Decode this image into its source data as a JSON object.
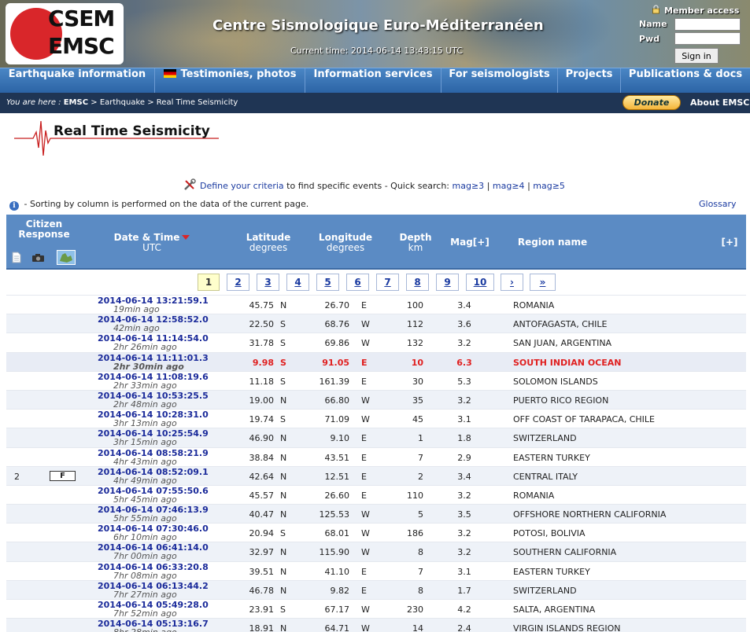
{
  "header": {
    "logo_line1": "CSEM",
    "logo_line2": "EMSC",
    "site_title": "Centre Sismologique Euro-Méditerranéen",
    "current_time_label": "Current time:",
    "current_time": "2014-06-14 13:43:15 UTC",
    "member_access": "Member access",
    "name_label": "Name",
    "pwd_label": "Pwd",
    "signin_label": "Sign in"
  },
  "nav": {
    "items": [
      {
        "label": "Earthquake information"
      },
      {
        "label": "Testimonies, photos",
        "icon": "german-flag-icon"
      },
      {
        "label": "Information services"
      },
      {
        "label": "For seismologists"
      },
      {
        "label": "Projects"
      },
      {
        "label": "Publications & docs"
      }
    ]
  },
  "breadcrumb": {
    "prefix": "You are here :",
    "emsc": "EMSC",
    "sep1": ">",
    "earthquake": "Earthquake",
    "sep2": ">",
    "current": "Real Time Seismicity"
  },
  "donate_label": "Donate",
  "about_label": "About EMSC",
  "page_title": "Real Time Seismicity",
  "criteria": {
    "link": "Define your criteria",
    "text": "to find specific events - Quick search:",
    "mag3": "mag≥3",
    "mag4": "mag≥4",
    "mag5": "mag≥5",
    "sep": "|"
  },
  "sort_note": "- Sorting by column is performed on the data of the current page.",
  "glossary": "Glossary",
  "table_header": {
    "citizen": "Citizen",
    "response": "Response",
    "datetime": "Date & Time",
    "utc": "UTC",
    "latitude": "Latitude",
    "lat_unit": "degrees",
    "longitude": "Longitude",
    "lon_unit": "degrees",
    "depth": "Depth",
    "depth_unit": "km",
    "mag": "Mag[+]",
    "region": "Region name",
    "expand": "[+]"
  },
  "pager": [
    "1",
    "2",
    "3",
    "4",
    "5",
    "6",
    "7",
    "8",
    "9",
    "10",
    "›",
    "»"
  ],
  "rows": [
    {
      "dt": "2014-06-14   13:21:59.1",
      "ago": "19min ago",
      "lat": "45.75",
      "ns": "N",
      "lon": "26.70",
      "ew": "E",
      "dep": "100",
      "mag": "3.4",
      "reg": "ROMANIA",
      "cit": "",
      "f": ""
    },
    {
      "dt": "2014-06-14   12:58:52.0",
      "ago": "42min ago",
      "lat": "22.50",
      "ns": "S",
      "lon": "68.76",
      "ew": "W",
      "dep": "112",
      "mag": "3.6",
      "reg": "ANTOFAGASTA, CHILE",
      "cit": "",
      "f": ""
    },
    {
      "dt": "2014-06-14   11:14:54.0",
      "ago": "2hr 26min ago",
      "lat": "31.78",
      "ns": "S",
      "lon": "69.86",
      "ew": "W",
      "dep": "132",
      "mag": "3.2",
      "reg": "SAN JUAN, ARGENTINA",
      "cit": "",
      "f": ""
    },
    {
      "dt": "2014-06-14   11:11:01.3",
      "ago": "2hr 30min ago",
      "lat": "9.98",
      "ns": "S",
      "lon": "91.05",
      "ew": "E",
      "dep": "10",
      "mag": "6.3",
      "reg": "SOUTH INDIAN OCEAN",
      "cit": "",
      "f": "",
      "red": true
    },
    {
      "dt": "2014-06-14   11:08:19.6",
      "ago": "2hr 33min ago",
      "lat": "11.18",
      "ns": "S",
      "lon": "161.39",
      "ew": "E",
      "dep": "30",
      "mag": "5.3",
      "reg": "SOLOMON ISLANDS",
      "cit": "",
      "f": ""
    },
    {
      "dt": "2014-06-14   10:53:25.5",
      "ago": "2hr 48min ago",
      "lat": "19.00",
      "ns": "N",
      "lon": "66.80",
      "ew": "W",
      "dep": "35",
      "mag": "3.2",
      "reg": "PUERTO RICO REGION",
      "cit": "",
      "f": ""
    },
    {
      "dt": "2014-06-14   10:28:31.0",
      "ago": "3hr 13min ago",
      "lat": "19.74",
      "ns": "S",
      "lon": "71.09",
      "ew": "W",
      "dep": "45",
      "mag": "3.1",
      "reg": "OFF COAST OF TARAPACA, CHILE",
      "cit": "",
      "f": ""
    },
    {
      "dt": "2014-06-14   10:25:54.9",
      "ago": "3hr 15min ago",
      "lat": "46.90",
      "ns": "N",
      "lon": "9.10",
      "ew": "E",
      "dep": "1",
      "mag": "1.8",
      "reg": "SWITZERLAND",
      "cit": "",
      "f": ""
    },
    {
      "dt": "2014-06-14   08:58:21.9",
      "ago": "4hr 43min ago",
      "lat": "38.84",
      "ns": "N",
      "lon": "43.51",
      "ew": "E",
      "dep": "7",
      "mag": "2.9",
      "reg": "EASTERN TURKEY",
      "cit": "",
      "f": ""
    },
    {
      "dt": "2014-06-14   08:52:09.1",
      "ago": "4hr 49min ago",
      "lat": "42.64",
      "ns": "N",
      "lon": "12.51",
      "ew": "E",
      "dep": "2",
      "mag": "3.4",
      "reg": "CENTRAL ITALY",
      "cit": "2",
      "f": "F"
    },
    {
      "dt": "2014-06-14   07:55:50.6",
      "ago": "5hr 45min ago",
      "lat": "45.57",
      "ns": "N",
      "lon": "26.60",
      "ew": "E",
      "dep": "110",
      "mag": "3.2",
      "reg": "ROMANIA",
      "cit": "",
      "f": ""
    },
    {
      "dt": "2014-06-14   07:46:13.9",
      "ago": "5hr 55min ago",
      "lat": "40.47",
      "ns": "N",
      "lon": "125.53",
      "ew": "W",
      "dep": "5",
      "mag": "3.5",
      "reg": "OFFSHORE NORTHERN CALIFORNIA",
      "cit": "",
      "f": ""
    },
    {
      "dt": "2014-06-14   07:30:46.0",
      "ago": "6hr 10min ago",
      "lat": "20.94",
      "ns": "S",
      "lon": "68.01",
      "ew": "W",
      "dep": "186",
      "mag": "3.2",
      "reg": "POTOSI, BOLIVIA",
      "cit": "",
      "f": ""
    },
    {
      "dt": "2014-06-14   06:41:14.0",
      "ago": "7hr 00min ago",
      "lat": "32.97",
      "ns": "N",
      "lon": "115.90",
      "ew": "W",
      "dep": "8",
      "mag": "3.2",
      "reg": "SOUTHERN CALIFORNIA",
      "cit": "",
      "f": ""
    },
    {
      "dt": "2014-06-14   06:33:20.8",
      "ago": "7hr 08min ago",
      "lat": "39.51",
      "ns": "N",
      "lon": "41.10",
      "ew": "E",
      "dep": "7",
      "mag": "3.1",
      "reg": "EASTERN TURKEY",
      "cit": "",
      "f": ""
    },
    {
      "dt": "2014-06-14   06:13:44.2",
      "ago": "7hr 27min ago",
      "lat": "46.78",
      "ns": "N",
      "lon": "9.82",
      "ew": "E",
      "dep": "8",
      "mag": "1.7",
      "reg": "SWITZERLAND",
      "cit": "",
      "f": ""
    },
    {
      "dt": "2014-06-14   05:49:28.0",
      "ago": "7hr 52min ago",
      "lat": "23.91",
      "ns": "S",
      "lon": "67.17",
      "ew": "W",
      "dep": "230",
      "mag": "4.2",
      "reg": "SALTA, ARGENTINA",
      "cit": "",
      "f": ""
    },
    {
      "dt": "2014-06-14   05:13:16.7",
      "ago": "8hr 28min ago",
      "lat": "18.91",
      "ns": "N",
      "lon": "64.71",
      "ew": "W",
      "dep": "14",
      "mag": "2.4",
      "reg": "VIRGIN ISLANDS REGION",
      "cit": "",
      "f": ""
    }
  ]
}
